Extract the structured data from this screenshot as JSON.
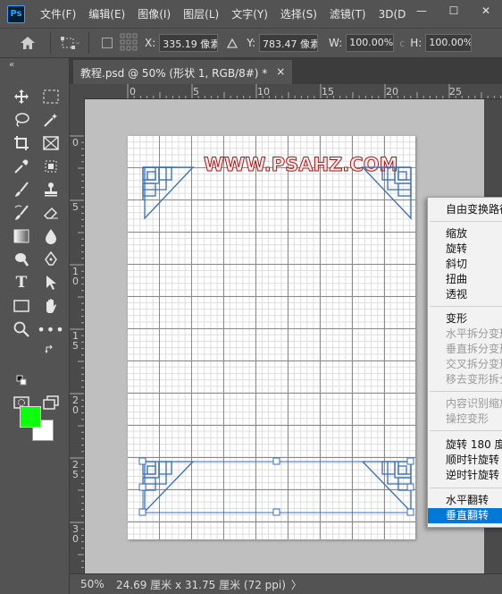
{
  "app": {
    "logo": "Ps"
  },
  "menubar": {
    "items": [
      "文件(F)",
      "编辑(E)",
      "图像(I)",
      "图层(L)",
      "文字(Y)",
      "选择(S)",
      "滤镜(T)",
      "3D(D)",
      "视图"
    ]
  },
  "window_controls": {
    "minimize": "—",
    "maximize": "☐",
    "close": "✕"
  },
  "options": {
    "x_label": "X:",
    "x_value": "335.19 像素",
    "y_label": "Y:",
    "y_value": "783.47 像素",
    "w_label": "W:",
    "w_value": "100.00%",
    "h_label": "H:",
    "h_value": "100.00%"
  },
  "document_tab": {
    "title": "教程.psd @ 50% (形状 1, RGB/8#) *",
    "close": "×"
  },
  "ruler": {
    "top": [
      "0",
      "5",
      "10",
      "15",
      "20",
      "25"
    ],
    "left": [
      "0",
      "5",
      "1\n0",
      "1\n5",
      "2\n0",
      "2\n5",
      "3\n0"
    ]
  },
  "canvas": {
    "watermark": "WWW.PSAHZ.COM"
  },
  "status": {
    "zoom": "50%",
    "doc_size": "24.69 厘米 x 31.75 厘米 (72 ppi)",
    "arrow": "〉"
  },
  "context_menu": {
    "items": [
      {
        "label": "自由变换路径",
        "state": "normal"
      },
      {
        "label": "缩放",
        "state": "normal"
      },
      {
        "label": "旋转",
        "state": "normal"
      },
      {
        "label": "斜切",
        "state": "normal"
      },
      {
        "label": "扭曲",
        "state": "normal"
      },
      {
        "label": "透视",
        "state": "normal"
      },
      {
        "label": "变形",
        "state": "normal"
      },
      {
        "label": "水平拆分变形",
        "state": "disabled"
      },
      {
        "label": "垂直拆分变形",
        "state": "disabled"
      },
      {
        "label": "交叉拆分变形",
        "state": "disabled"
      },
      {
        "label": "移去变形拆分",
        "state": "disabled"
      },
      {
        "label": "内容识别缩放",
        "state": "disabled"
      },
      {
        "label": "操控变形",
        "state": "disabled"
      },
      {
        "label": "旋转 180 度",
        "state": "normal"
      },
      {
        "label": "顺时针旋转",
        "state": "normal"
      },
      {
        "label": "逆时针旋转",
        "state": "normal"
      },
      {
        "label": "水平翻转",
        "state": "normal"
      },
      {
        "label": "垂直翻转",
        "state": "selected"
      }
    ]
  },
  "colors": {
    "foreground": "#0dff0d",
    "background": "#ffffff",
    "path": "#3a6fb0",
    "menu_highlight": "#0078d7"
  }
}
